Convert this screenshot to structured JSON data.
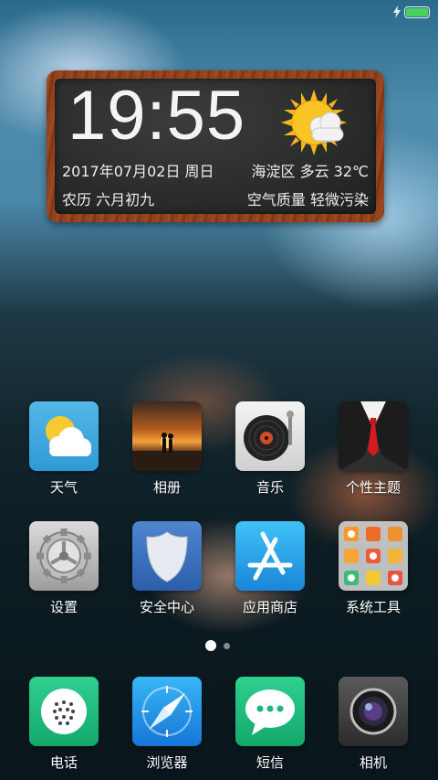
{
  "status_bar": {
    "battery_level": 1.0,
    "charging": true,
    "battery_color": "#48d35e"
  },
  "clock_widget": {
    "time": "19:55",
    "date": "2017年07月02日 周日",
    "lunar_date": "农历 六月初九",
    "weather": "海淀区 多云 32℃",
    "air_quality": "空气质量 轻微污染",
    "weather_icon": "sun-cloud-icon"
  },
  "apps_row1": [
    {
      "label": "天气",
      "icon": "weather-icon"
    },
    {
      "label": "相册",
      "icon": "gallery-icon"
    },
    {
      "label": "音乐",
      "icon": "music-icon"
    },
    {
      "label": "个性主题",
      "icon": "themes-icon"
    }
  ],
  "apps_row2": [
    {
      "label": "设置",
      "icon": "settings-gear-icon"
    },
    {
      "label": "安全中心",
      "icon": "security-shield-icon"
    },
    {
      "label": "应用商店",
      "icon": "app-store-icon"
    },
    {
      "label": "系统工具",
      "icon": "tools-folder-icon"
    }
  ],
  "page_indicator": {
    "current_page": 1,
    "total_pages": 2
  },
  "dock": [
    {
      "label": "电话",
      "icon": "phone-icon"
    },
    {
      "label": "浏览器",
      "icon": "browser-compass-icon"
    },
    {
      "label": "短信",
      "icon": "messages-icon"
    },
    {
      "label": "相机",
      "icon": "camera-icon"
    }
  ]
}
